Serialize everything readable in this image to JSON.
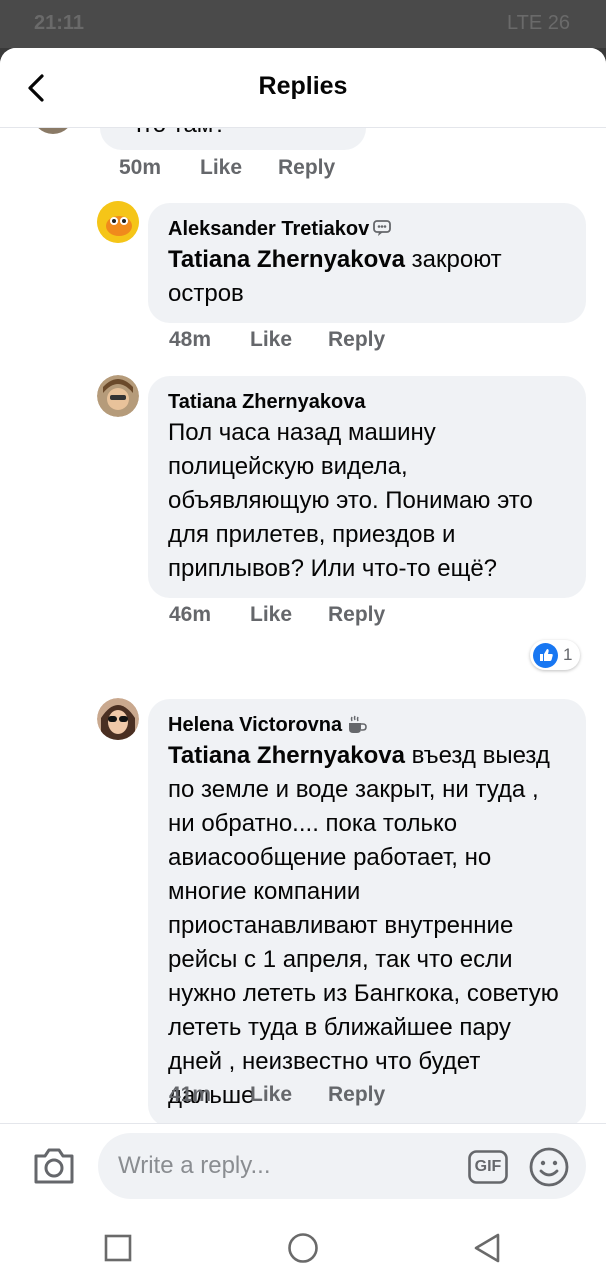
{
  "status_bar": {
    "time": "21:11",
    "right": "LTE  26"
  },
  "header": {
    "title": "Replies",
    "back_icon": "chevron-left-icon"
  },
  "comments": [
    {
      "partial_text": "Что там?",
      "time": "50m",
      "like": "Like",
      "reply": "Reply"
    },
    {
      "author": "Aleksander Tretiakov",
      "badge": "chat-bubble-icon",
      "mention": "Tatiana Zhernyakova",
      "text": " закроют остров",
      "time": "48m",
      "like": "Like",
      "reply": "Reply"
    },
    {
      "author": "Tatiana Zhernyakova",
      "text": "Пол часа назад машину полицейскую видела, объявляющую это. Понимаю это для прилетев, приездов и приплывов? Или что-то ещё?",
      "time": "46m",
      "like": "Like",
      "reply": "Reply",
      "reaction_count": "1"
    },
    {
      "author": "Helena Victorovna",
      "badge": "coffee-cup-icon",
      "mention": "Tatiana Zhernyakova",
      "text": " въезд выезд по земле и воде закрыт, ни туда , ни обратно.... пока только авиасообщение работает, но многие компании приостанавливают внутренние рейсы с 1 апреля, так что если нужно лететь из Бангкока, советую лететь туда в ближайшее пару дней , неизвестно что будет дальше",
      "time": "41m",
      "like": "Like",
      "reply": "Reply"
    }
  ],
  "composer": {
    "placeholder": "Write a reply...",
    "gif_label": "GIF"
  },
  "colors": {
    "bubble": "#f0f2f5",
    "meta": "#65676b",
    "like_blue": "#1877f2"
  }
}
